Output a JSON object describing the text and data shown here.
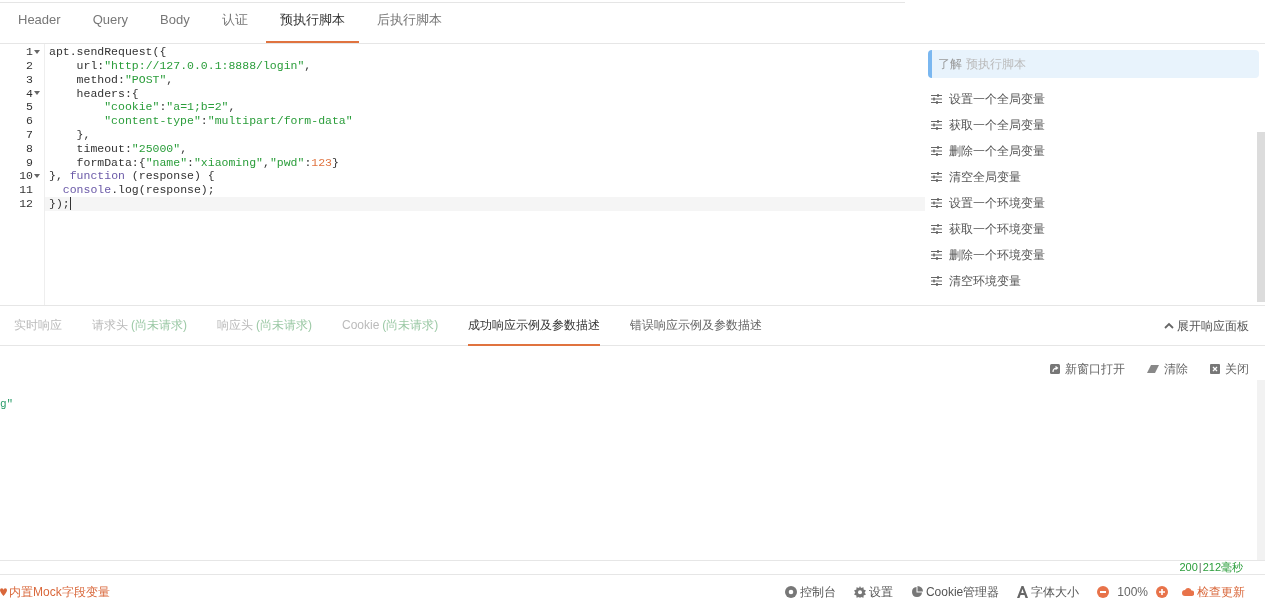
{
  "request_tabs": [
    {
      "label": "Header",
      "selected": false
    },
    {
      "label": "Query",
      "selected": false
    },
    {
      "label": "Body",
      "selected": false
    },
    {
      "label": "认证",
      "selected": false
    },
    {
      "label": "预执行脚本",
      "selected": true
    },
    {
      "label": "后执行脚本",
      "selected": false
    }
  ],
  "editor": {
    "lines": [
      {
        "number": "1",
        "foldable": true,
        "active": false,
        "tokens": [
          {
            "kind": "plain",
            "text": "apt.sendRequest({"
          }
        ]
      },
      {
        "number": "2",
        "foldable": false,
        "active": false,
        "tokens": [
          {
            "kind": "plain",
            "text": "    url:"
          },
          {
            "kind": "string",
            "text": "\"http://127.0.0.1:8888/login\""
          },
          {
            "kind": "plain",
            "text": ","
          }
        ]
      },
      {
        "number": "3",
        "foldable": false,
        "active": false,
        "tokens": [
          {
            "kind": "plain",
            "text": "    method:"
          },
          {
            "kind": "string",
            "text": "\"POST\""
          },
          {
            "kind": "plain",
            "text": ","
          }
        ]
      },
      {
        "number": "4",
        "foldable": true,
        "active": false,
        "tokens": [
          {
            "kind": "plain",
            "text": "    headers:{"
          }
        ]
      },
      {
        "number": "5",
        "foldable": false,
        "active": false,
        "tokens": [
          {
            "kind": "string",
            "text": "        \"cookie\""
          },
          {
            "kind": "plain",
            "text": ":"
          },
          {
            "kind": "string",
            "text": "\"a=1;b=2\""
          },
          {
            "kind": "plain",
            "text": ","
          }
        ]
      },
      {
        "number": "6",
        "foldable": false,
        "active": false,
        "tokens": [
          {
            "kind": "string",
            "text": "        \"content-type\""
          },
          {
            "kind": "plain",
            "text": ":"
          },
          {
            "kind": "string",
            "text": "\"multipart/form-data\""
          }
        ]
      },
      {
        "number": "7",
        "foldable": false,
        "active": false,
        "tokens": [
          {
            "kind": "plain",
            "text": "    },"
          }
        ]
      },
      {
        "number": "8",
        "foldable": false,
        "active": false,
        "tokens": [
          {
            "kind": "plain",
            "text": "    timeout:"
          },
          {
            "kind": "string",
            "text": "\"25000\""
          },
          {
            "kind": "plain",
            "text": ","
          }
        ]
      },
      {
        "number": "9",
        "foldable": false,
        "active": false,
        "tokens": [
          {
            "kind": "plain",
            "text": "    formData:{"
          },
          {
            "kind": "string",
            "text": "\"name\""
          },
          {
            "kind": "plain",
            "text": ":"
          },
          {
            "kind": "string",
            "text": "\"xiaoming\""
          },
          {
            "kind": "plain",
            "text": ","
          },
          {
            "kind": "string",
            "text": "\"pwd\""
          },
          {
            "kind": "plain",
            "text": ":"
          },
          {
            "kind": "number",
            "text": "123"
          },
          {
            "kind": "plain",
            "text": "}"
          }
        ]
      },
      {
        "number": "10",
        "foldable": true,
        "active": false,
        "tokens": [
          {
            "kind": "plain",
            "text": "}, "
          },
          {
            "kind": "keyword",
            "text": "function"
          },
          {
            "kind": "plain",
            "text": " (response) {"
          }
        ]
      },
      {
        "number": "11",
        "foldable": false,
        "active": false,
        "tokens": [
          {
            "kind": "keyword",
            "text": "  console"
          },
          {
            "kind": "plain",
            "text": ".log(response);"
          }
        ]
      },
      {
        "number": "12",
        "foldable": false,
        "active": true,
        "tokens": [
          {
            "kind": "plain",
            "text": "});"
          }
        ]
      }
    ]
  },
  "snippets": {
    "hint_label": "了解",
    "hint_link": "预执行脚本",
    "items": [
      "设置一个全局变量",
      "获取一个全局变量",
      "删除一个全局变量",
      "清空全局变量",
      "设置一个环境变量",
      "获取一个环境变量",
      "删除一个环境变量",
      "清空环境变量"
    ]
  },
  "response_tabs": [
    {
      "label": "实时响应",
      "disabled": true,
      "selected": false
    },
    {
      "label": "请求头",
      "note": "(尚未请求)",
      "disabled": true,
      "selected": false
    },
    {
      "label": "响应头",
      "note": "(尚未请求)",
      "disabled": true,
      "selected": false
    },
    {
      "label": "Cookie",
      "note": "(尚未请求)",
      "disabled": true,
      "selected": false
    },
    {
      "label": "成功响应示例及参数描述",
      "disabled": false,
      "selected": true
    },
    {
      "label": "错误响应示例及参数描述",
      "disabled": false,
      "selected": false
    }
  ],
  "expand_panel": "展开响应面板",
  "response_actions": [
    {
      "kind": "open",
      "label": "新窗口打开"
    },
    {
      "kind": "clear",
      "label": "清除"
    },
    {
      "kind": "close",
      "label": "关闭"
    }
  ],
  "response_fragment": "g\"",
  "status": {
    "code": "200",
    "separator": "|",
    "time": "212毫秒"
  },
  "footer": {
    "mock_link": "内置Mock字段变量",
    "items": [
      {
        "kind": "console",
        "label": "控制台"
      },
      {
        "kind": "settings",
        "label": "设置"
      },
      {
        "kind": "cookie",
        "label": "Cookie管理器"
      },
      {
        "kind": "font",
        "label": "字体大小"
      }
    ],
    "zoom": "100%",
    "update": "检查更新"
  }
}
